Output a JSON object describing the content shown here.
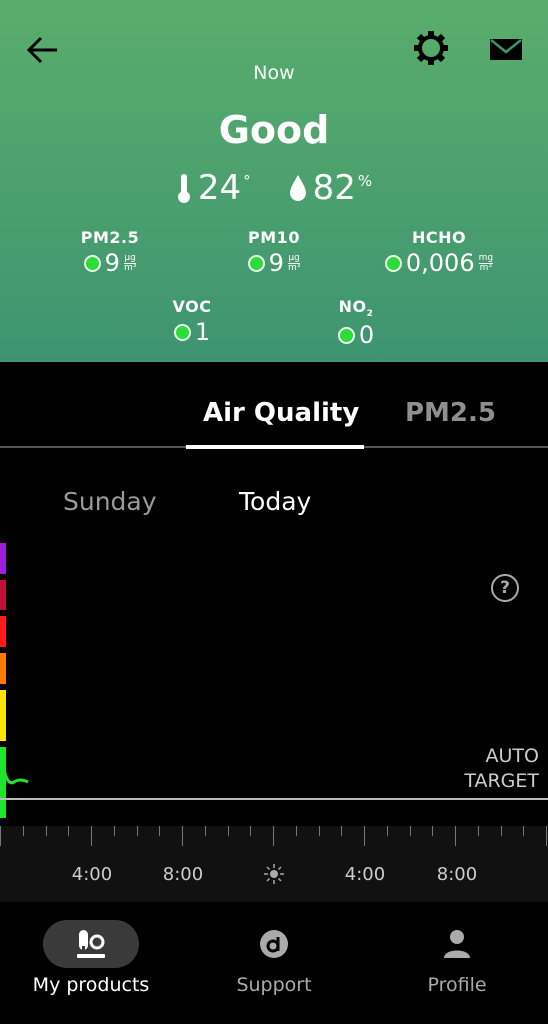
{
  "header": {
    "now_label": "Now",
    "status": "Good",
    "temperature": "24",
    "temperature_unit": "°",
    "humidity": "82",
    "humidity_unit": "%"
  },
  "metrics": [
    {
      "name": "PM2.5",
      "value": "9",
      "unit_top": "µg",
      "unit_bottom": "m³"
    },
    {
      "name": "PM10",
      "value": "9",
      "unit_top": "µg",
      "unit_bottom": "m³"
    },
    {
      "name": "HCHO",
      "value": "0,006",
      "unit_top": "mg",
      "unit_bottom": "m³"
    },
    {
      "name": "VOC",
      "value": "1"
    },
    {
      "name": "NO",
      "name_sub": "2",
      "value": "0"
    }
  ],
  "tabs": [
    {
      "label": "Air Quality",
      "active": true
    },
    {
      "label": "PM2.5",
      "active": false
    }
  ],
  "days": {
    "prev": "Sunday",
    "current": "Today"
  },
  "chart": {
    "help_symbol": "?",
    "auto_target_line1": "AUTO",
    "auto_target_line2": "TARGET",
    "scale_colors": [
      "#9b1fd6",
      "#c0103a",
      "#ff1a1a",
      "#ff7a00",
      "#ffe600",
      "#20e32b"
    ],
    "time_labels": [
      "4:00",
      "8:00",
      "4:00",
      "8:00"
    ]
  },
  "nav": [
    {
      "label": "My products",
      "icon": "products-icon",
      "active": true
    },
    {
      "label": "Support",
      "icon": "support-icon",
      "active": false
    },
    {
      "label": "Profile",
      "icon": "profile-icon",
      "active": false
    }
  ]
}
